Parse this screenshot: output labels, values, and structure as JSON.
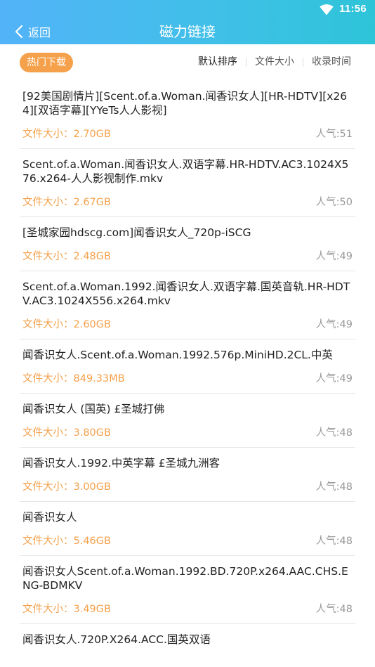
{
  "status": {
    "time": "11:56"
  },
  "header": {
    "back_label": "返回",
    "title": "磁力链接"
  },
  "toolbar": {
    "hot_label": "热门下载",
    "sort_options": [
      "默认排序",
      "文件大小",
      "收录时间"
    ]
  },
  "list": [
    {
      "title": "[92美国剧情片][Scent.of.a.Woman.闻香识女人][HR-HDTV][x264][双语字幕][YYeTs人人影视]",
      "size": "文件大小：2.70GB",
      "popularity": "人气:51"
    },
    {
      "title": "Scent.of.a.Woman.闻香识女人.双语字幕.HR-HDTV.AC3.1024X576.x264-人人影视制作.mkv",
      "size": "文件大小：2.67GB",
      "popularity": "人气:50"
    },
    {
      "title": "[圣城家园hdscg.com]闻香识女人_720p-iSCG",
      "size": "文件大小：2.48GB",
      "popularity": "人气:49"
    },
    {
      "title": "Scent.of.a.Woman.1992.闻香识女人.双语字幕.国英音轨.HR-HDTV.AC3.1024X556.x264.mkv",
      "size": "文件大小：2.60GB",
      "popularity": "人气:49"
    },
    {
      "title": "闻香识女人.Scent.of.a.Woman.1992.576p.MiniHD.2CL.中英",
      "size": "文件大小：849.33MB",
      "popularity": "人气:49"
    },
    {
      "title": "闻香识女人 (国英) £圣城打佛",
      "size": "文件大小：3.80GB",
      "popularity": "人气:48"
    },
    {
      "title": "闻香识女人.1992.中英字幕 £圣城九洲客",
      "size": "文件大小：3.00GB",
      "popularity": "人气:48"
    },
    {
      "title": "闻香识女人",
      "size": "文件大小：5.46GB",
      "popularity": "人气:48"
    },
    {
      "title": "闻香识女人Scent.of.a.Woman.1992.BD.720P.x264.AAC.CHS.ENG-BDMKV",
      "size": "文件大小：3.49GB",
      "popularity": "人气:48"
    },
    {
      "title": "闻香识女人.720P.X264.ACC.国英双语",
      "size": "",
      "popularity": ""
    }
  ],
  "colors": {
    "accent": "#f5a04a",
    "header_start": "#52b3f8",
    "header_end": "#2ec4d8"
  },
  "icons": {
    "wifi": "wifi-icon",
    "back": "chevron-left-icon"
  }
}
